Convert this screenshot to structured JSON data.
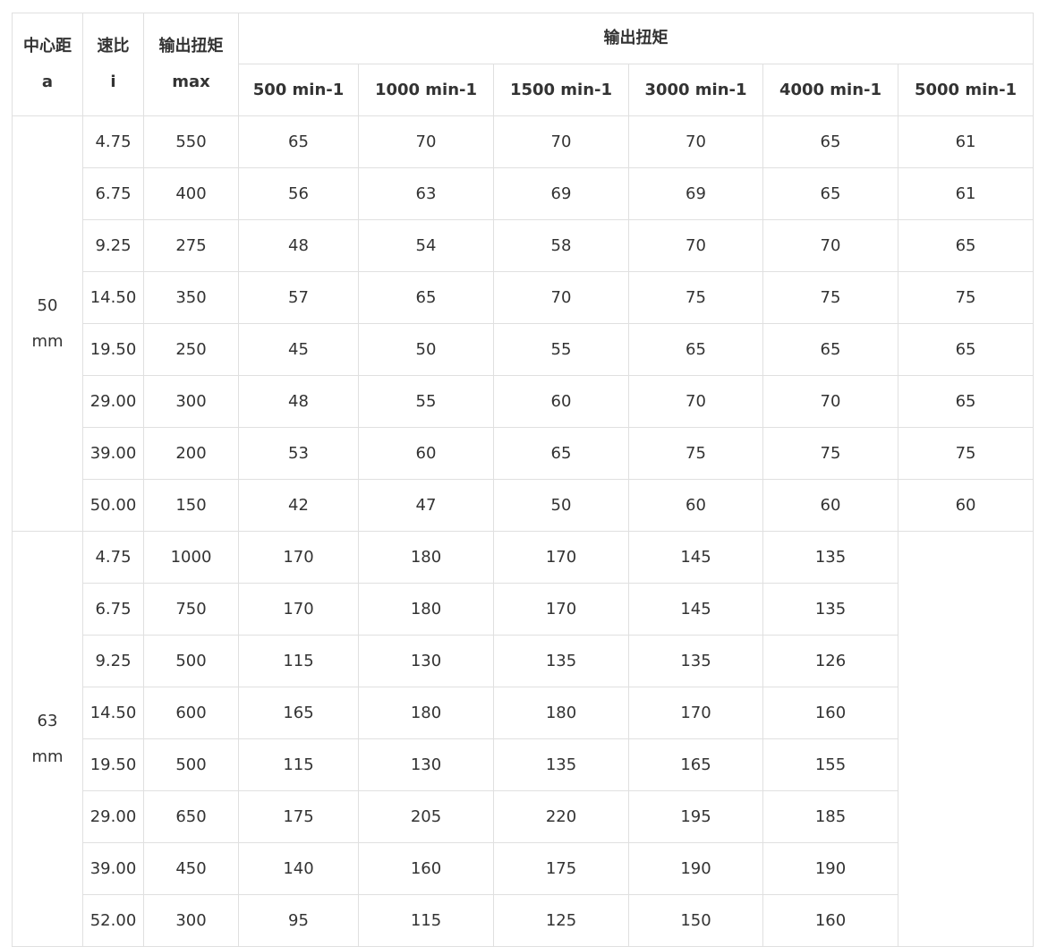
{
  "header": {
    "center_distance": [
      "中心距",
      "a"
    ],
    "ratio": [
      "速比",
      "i"
    ],
    "max_torque": [
      "输出扭矩",
      "max"
    ],
    "output_torque_group": "输出扭矩",
    "speeds": [
      "500 min-1",
      "1000 min-1",
      "1500 min-1",
      "3000 min-1",
      "4000 min-1",
      "5000 min-1"
    ]
  },
  "groups": [
    {
      "label": [
        "50",
        "mm"
      ],
      "rows": [
        {
          "ratio": "4.75",
          "max": "550",
          "values": [
            "65",
            "70",
            "70",
            "70",
            "65",
            "61"
          ]
        },
        {
          "ratio": "6.75",
          "max": "400",
          "values": [
            "56",
            "63",
            "69",
            "69",
            "65",
            "61"
          ]
        },
        {
          "ratio": "9.25",
          "max": "275",
          "values": [
            "48",
            "54",
            "58",
            "70",
            "70",
            "65"
          ]
        },
        {
          "ratio": "14.50",
          "max": "350",
          "values": [
            "57",
            "65",
            "70",
            "75",
            "75",
            "75"
          ]
        },
        {
          "ratio": "19.50",
          "max": "250",
          "values": [
            "45",
            "50",
            "55",
            "65",
            "65",
            "65"
          ]
        },
        {
          "ratio": "29.00",
          "max": "300",
          "values": [
            "48",
            "55",
            "60",
            "70",
            "70",
            "65"
          ]
        },
        {
          "ratio": "39.00",
          "max": "200",
          "values": [
            "53",
            "60",
            "65",
            "75",
            "75",
            "75"
          ]
        },
        {
          "ratio": "50.00",
          "max": "150",
          "values": [
            "42",
            "47",
            "50",
            "60",
            "60",
            "60"
          ]
        }
      ]
    },
    {
      "label": [
        "63",
        "mm"
      ],
      "rows": [
        {
          "ratio": "4.75",
          "max": "1000",
          "values": [
            "170",
            "180",
            "170",
            "145",
            "135"
          ]
        },
        {
          "ratio": "6.75",
          "max": "750",
          "values": [
            "170",
            "180",
            "170",
            "145",
            "135"
          ]
        },
        {
          "ratio": "9.25",
          "max": "500",
          "values": [
            "115",
            "130",
            "135",
            "135",
            "126"
          ]
        },
        {
          "ratio": "14.50",
          "max": "600",
          "values": [
            "165",
            "180",
            "180",
            "170",
            "160"
          ]
        },
        {
          "ratio": "19.50",
          "max": "500",
          "values": [
            "115",
            "130",
            "135",
            "165",
            "155"
          ]
        },
        {
          "ratio": "29.00",
          "max": "650",
          "values": [
            "175",
            "205",
            "220",
            "195",
            "185"
          ]
        },
        {
          "ratio": "39.00",
          "max": "450",
          "values": [
            "140",
            "160",
            "175",
            "190",
            "190"
          ]
        },
        {
          "ratio": "52.00",
          "max": "300",
          "values": [
            "95",
            "115",
            "125",
            "150",
            "160"
          ]
        }
      ]
    }
  ]
}
